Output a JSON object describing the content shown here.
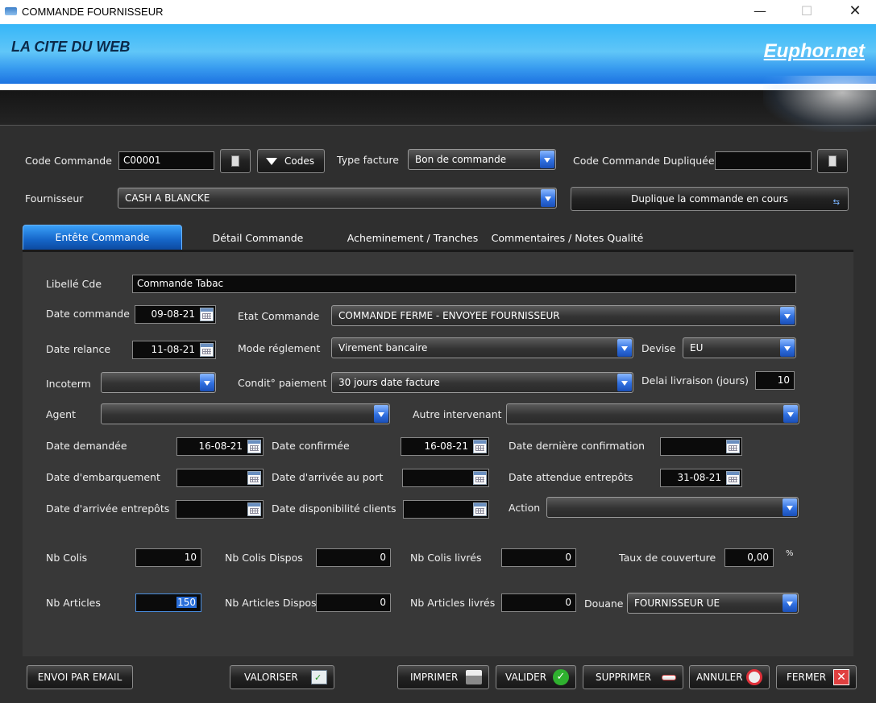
{
  "window": {
    "title": "COMMANDE FOURNISSEUR"
  },
  "banner": {
    "brand": "LA CITE DU WEB",
    "logo_text": "Euphor.net"
  },
  "header": {
    "code_commande_label": "Code Commande",
    "code_commande_value": "C00001",
    "codes_button": "Codes",
    "type_facture_label": "Type facture",
    "type_facture_value": "Bon de commande",
    "code_dupliquee_label": "Code Commande Dupliquée",
    "code_dupliquee_value": "",
    "fournisseur_label": "Fournisseur",
    "fournisseur_value": "CASH A BLANCKE",
    "duplique_button": "Duplique la commande en cours"
  },
  "tabs": [
    {
      "label": "Entête Commande",
      "active": true
    },
    {
      "label": "Détail Commande"
    },
    {
      "label": "Acheminement / Tranches"
    },
    {
      "label": "Commentaires / Notes Qualité"
    }
  ],
  "form": {
    "libelle_label": "Libellé Cde",
    "libelle_value": "Commande Tabac",
    "date_commande_label": "Date commande",
    "date_commande_value": "09-08-21",
    "etat_label": "Etat Commande",
    "etat_value": "COMMANDE FERME - ENVOYEE FOURNISSEUR",
    "date_relance_label": "Date relance",
    "date_relance_value": "11-08-21",
    "mode_reglement_label": "Mode réglement",
    "mode_reglement_value": "Virement bancaire",
    "devise_label": "Devise",
    "devise_value": "EU",
    "incoterm_label": "Incoterm",
    "incoterm_value": "",
    "condit_label": "Condit° paiement",
    "condit_value": "30 jours date facture",
    "delai_label": "Delai livraison (jours)",
    "delai_value": "10",
    "agent_label": "Agent",
    "agent_value": "",
    "autre_label": "Autre intervenant",
    "autre_value": "",
    "date_demandee_label": "Date demandée",
    "date_demandee_value": "16-08-21",
    "date_confirmee_label": "Date confirmée",
    "date_confirmee_value": "16-08-21",
    "date_derniere_label": "Date dernière confirmation",
    "date_derniere_value": "",
    "date_embarq_label": "Date d'embarquement",
    "date_embarq_value": "",
    "date_port_label": "Date d'arrivée au port",
    "date_port_value": "",
    "date_attendue_label": "Date attendue entrepôts",
    "date_attendue_value": "31-08-21",
    "date_arrivee_label": "Date d'arrivée entrepôts",
    "date_arrivee_value": "",
    "date_dispo_label": "Date disponibilité clients",
    "date_dispo_value": "",
    "action_label": "Action",
    "action_value": "",
    "nb_colis_label": "Nb Colis",
    "nb_colis_value": "10",
    "nb_colis_dispos_label": "Nb Colis Dispos",
    "nb_colis_dispos_value": "0",
    "nb_colis_livres_label": "Nb Colis livrés",
    "nb_colis_livres_value": "0",
    "taux_label": "Taux de couverture",
    "taux_value": "0,00",
    "taux_unit": "%",
    "nb_articles_label": "Nb Articles",
    "nb_articles_value": "150",
    "nb_articles_dispos_label": "Nb Articles Dispos",
    "nb_articles_dispos_value": "0",
    "nb_articles_livres_label": "Nb Articles livrés",
    "nb_articles_livres_value": "0",
    "douane_label": "Douane",
    "douane_value": "FOURNISSEUR UE"
  },
  "footer": {
    "envoi": "ENVOI PAR EMAIL",
    "valoriser": "VALORISER",
    "imprimer": "IMPRIMER",
    "valider": "VALIDER",
    "supprimer": "SUPPRIMER",
    "annuler": "ANNULER",
    "fermer": "FERMER"
  },
  "colors": {
    "accent": "#2f6fe0",
    "banner": "#36b6f8",
    "panel": "#383838"
  }
}
